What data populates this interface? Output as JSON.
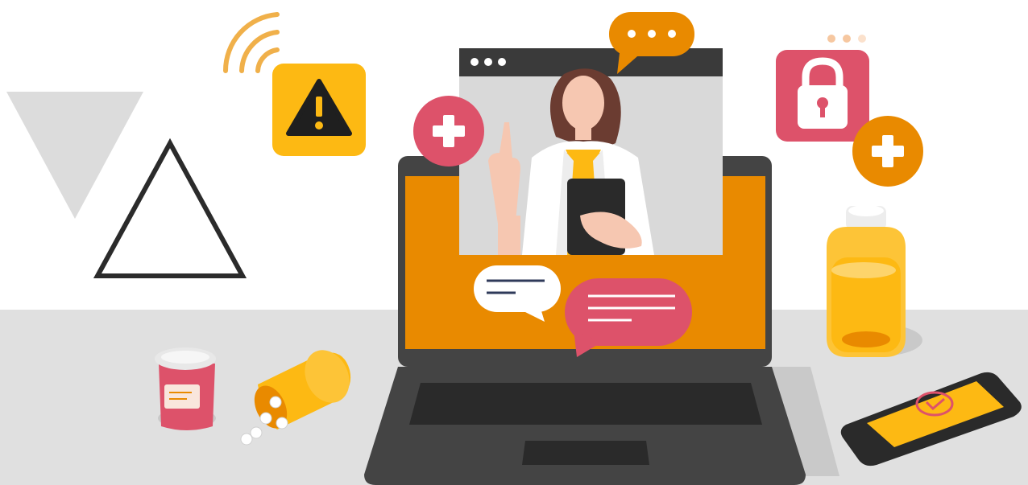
{
  "scene": {
    "description_icons": [
      "wifi-icon",
      "warning-icon",
      "lock-icon",
      "plus-icon",
      "chat-bubble-icon",
      "typing-dots-icon"
    ],
    "colors": {
      "background": "#ffffff",
      "desk": "#e0e0e0",
      "orange": "#e98a00",
      "yellow": "#fdb913",
      "pink": "#dd526a",
      "dark": "#333333",
      "laptop_body": "#444444",
      "screen_bg": "#d9d9d9",
      "window_bar": "#3a3a3a"
    }
  }
}
